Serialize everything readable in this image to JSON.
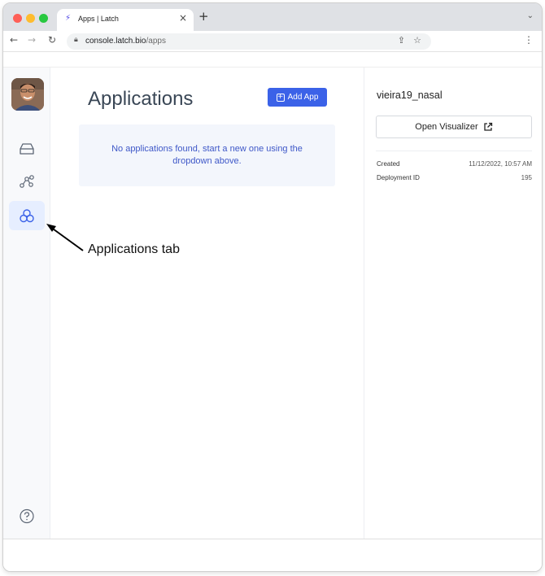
{
  "browser": {
    "tab_title": "Apps | Latch",
    "new_tab_symbol": "+",
    "url_host": "console.latch.bio",
    "url_path": "/apps"
  },
  "sidebar": {
    "items": [
      {
        "name": "data",
        "icon": "drive-icon"
      },
      {
        "name": "workflows",
        "icon": "graph-nodes-icon"
      },
      {
        "name": "applications",
        "icon": "hexagons-icon",
        "active": true
      }
    ],
    "help_icon": "help-bubble-icon"
  },
  "main": {
    "title": "Applications",
    "add_button_label": "Add App",
    "empty_message": "No applications found, start a new one using the dropdown above."
  },
  "details": {
    "deployment_name": "vieira19_nasal",
    "visualizer_button_label": "Open Visualizer",
    "rows": [
      {
        "label": "Created",
        "value": "11/12/2022, 10:57 AM"
      },
      {
        "label": "Deployment ID",
        "value": "195"
      }
    ]
  },
  "annotation": {
    "label": "Applications tab"
  },
  "colors": {
    "accent": "#3b62e8",
    "active_tab_bg": "#e6eeff",
    "empty_text": "#3f58c8"
  }
}
